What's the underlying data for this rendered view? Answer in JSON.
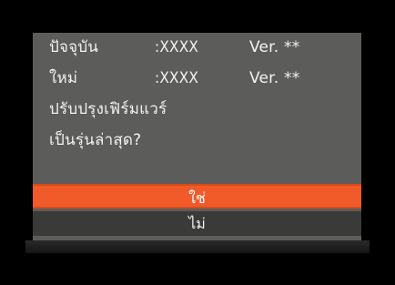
{
  "colors": {
    "screen_bg": "#5c5c5a",
    "selection": "#f15a29",
    "unselected": "#3a3a38",
    "text": "#f2f2f2"
  },
  "info": {
    "current": {
      "label": "ปัจจุบัน",
      "value": ":XXXX",
      "version": "Ver. **"
    },
    "new": {
      "label": "ใหม่",
      "value": ":XXXX",
      "version": "Ver. **"
    }
  },
  "prompt": {
    "line1": "ปรับปรุงเฟิร์มแวร์",
    "line2": "เป็นรุ่นล่าสุด?"
  },
  "menu": {
    "yes": "ใช่",
    "no": "ไม่",
    "selected": "yes"
  }
}
